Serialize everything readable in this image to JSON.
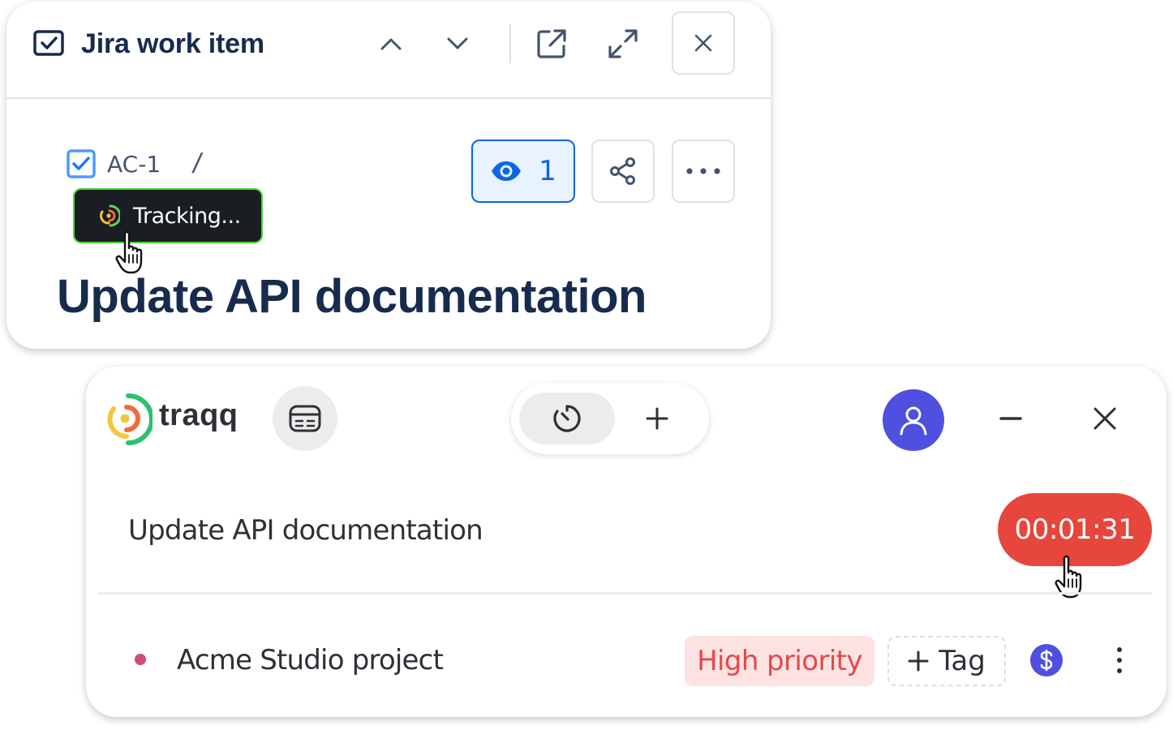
{
  "jira": {
    "header_title": "Jira work item",
    "breadcrumb_key": "AC-1",
    "breadcrumb_separator": "/",
    "watch_count": "1",
    "tracking_label": "Tracking...",
    "issue_title": "Update API documentation",
    "colors": {
      "accent_blue": "#0c66e4",
      "tracking_border": "#4bd43a"
    }
  },
  "traqq": {
    "app_name": "traqq",
    "task_name": "Update API documentation",
    "timer": "00:01:31",
    "project_name": "Acme Studio project",
    "priority_label": "High priority",
    "tag_label": "Tag",
    "colors": {
      "timer_bg": "#e6463c",
      "avatar_bg": "#4f4fe0",
      "priority_text": "#e5484d",
      "project_dot": "#d14a7c"
    }
  }
}
